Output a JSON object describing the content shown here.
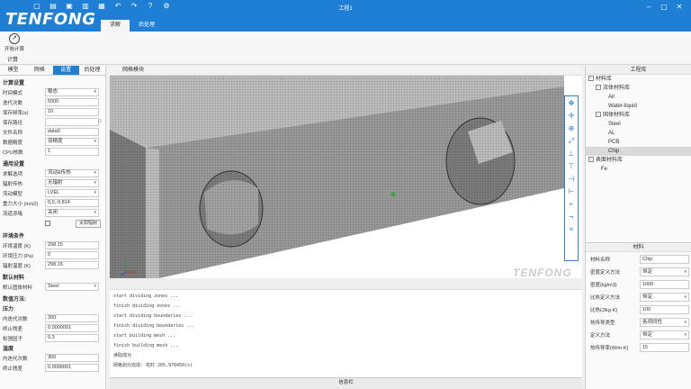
{
  "app": {
    "logo": "TENFONG",
    "window_title": "工程1",
    "tabs": [
      "求解",
      "后处理"
    ],
    "active_tab": 0
  },
  "ribbon": {
    "start_label": "开始计算",
    "group_label": "计算"
  },
  "left_panel": {
    "tabs": [
      "模型",
      "网格",
      "设置",
      "后处理"
    ],
    "active_tab": 2,
    "sections": {
      "calc_title": "计算设置",
      "general_title": "通用设置",
      "env_title": "环境条件",
      "default_mat_title": "默认材料",
      "numeric_title": "数值方法:",
      "pressure_title": "压力",
      "temp_title": "温度"
    },
    "calc": [
      {
        "label": "时间模式",
        "value": "稳态",
        "select": true
      },
      {
        "label": "迭代次数",
        "value": "5000"
      },
      {
        "label": "保存频率(s)",
        "value": "10"
      },
      {
        "label": "保存路径",
        "value": ""
      },
      {
        "label": "文件名称",
        "value": "data0"
      },
      {
        "label": "数据精度",
        "value": "双精度",
        "select": true
      },
      {
        "label": "CPU核数",
        "value": "1"
      }
    ],
    "general": [
      {
        "label": "求解选项",
        "value": "流动&传热",
        "select": true
      },
      {
        "label": "辐射传热",
        "value": "无辐射",
        "select": true
      },
      {
        "label": "流动模型",
        "value": "LVEL",
        "select": true
      },
      {
        "label": "重力大小 (m/s2)",
        "value": "0,0,-9.814"
      },
      {
        "label": "流道添堵",
        "value": "关闭",
        "select": true
      }
    ],
    "sun_button": "太阳辐射",
    "env": [
      {
        "label": "环境温度 (K)",
        "value": "298.15"
      },
      {
        "label": "环境压力 (Pa)",
        "value": "0"
      },
      {
        "label": "辐射温度 (K)",
        "value": "298.15"
      }
    ],
    "default_mat": [
      {
        "label": "默认固体材料",
        "value": "Steel",
        "select": true
      }
    ],
    "pressure": [
      {
        "label": "内迭代次数",
        "value": "300"
      },
      {
        "label": "终止残差",
        "value": "0.0000001"
      },
      {
        "label": "松弛因子",
        "value": "0.3"
      }
    ],
    "temperature": [
      {
        "label": "内迭代次数",
        "value": "300"
      },
      {
        "label": "终止残差",
        "value": "0.0000001"
      }
    ]
  },
  "center": {
    "title": "网格模块",
    "watermark": "TENFONG",
    "log_lines": [
      "start dividing zones ...",
      "finish dividing zones ...",
      "start dividing boundaries ...",
      "finish dividing boundaries ...",
      "start building mesh ...",
      "finish building mesh ...",
      "读取成功",
      "网格划分完成: 花时 205.970450(s)"
    ],
    "log_title": "信息栏"
  },
  "right_panel": {
    "title": "工程库",
    "tree": {
      "root": "材料库",
      "fluid_group": "流体材料库",
      "fluids": [
        "Air",
        "Water-liquid"
      ],
      "solid_group": "固体材料库",
      "solids": [
        "Steel",
        "AL",
        "PCB",
        "Chip"
      ],
      "selected": "Chip",
      "surface_group": "表面材料库",
      "surfaces": [
        "Fe"
      ]
    },
    "material": {
      "title": "材料",
      "fields": [
        {
          "label": "材料名称",
          "value": "Chip"
        },
        {
          "label": "密度定义方法",
          "value": "恒定",
          "select": true
        },
        {
          "label": "密度(kg/m3)",
          "value": "1000"
        },
        {
          "label": "比热定义方法",
          "value": "恒定",
          "select": true
        },
        {
          "label": "比热(J/kg·K)",
          "value": "100"
        },
        {
          "label": "热传导类型",
          "value": "各项同性",
          "select": true
        },
        {
          "label": "定义方法",
          "value": "恒定",
          "select": true
        },
        {
          "label": "热传导率(W/m·K)",
          "value": "15"
        }
      ]
    }
  }
}
